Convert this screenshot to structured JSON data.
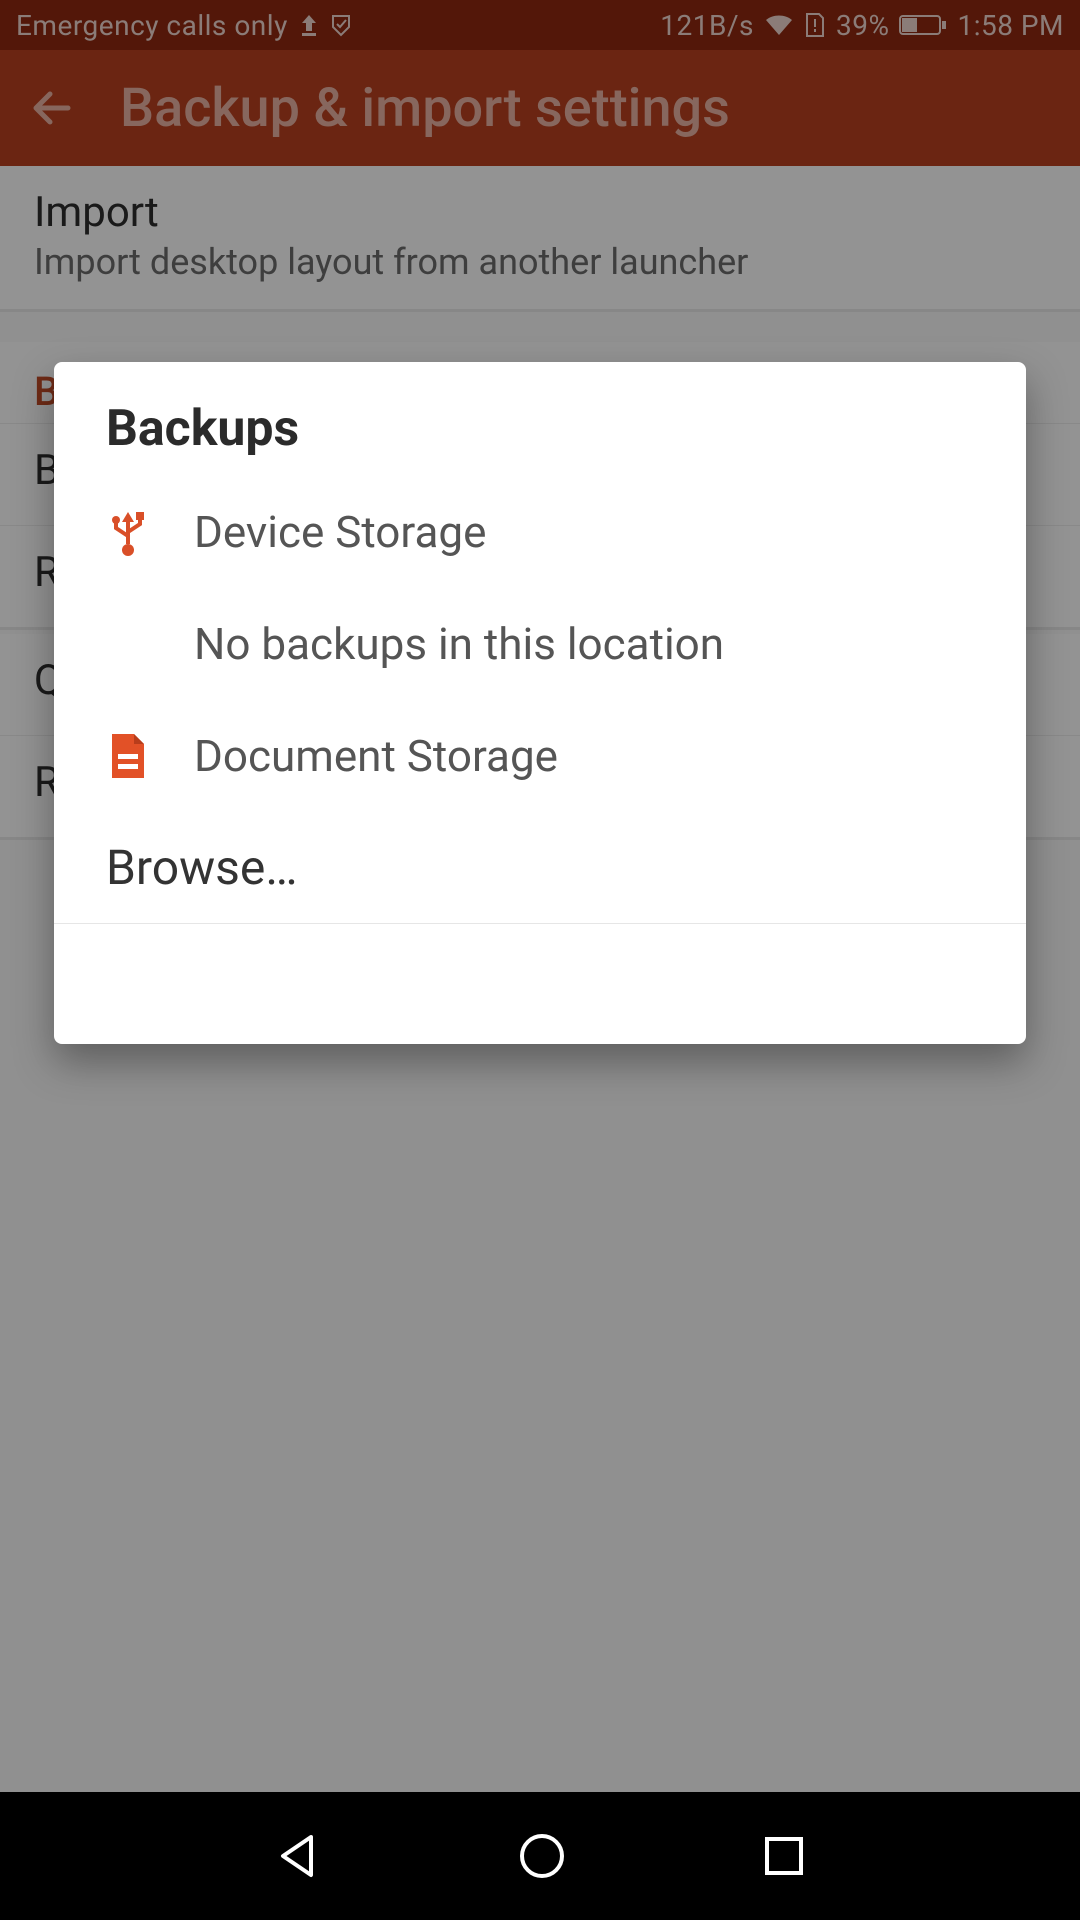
{
  "status": {
    "network_text": "Emergency calls only",
    "data_rate": "121B/s",
    "battery_pct": "39%",
    "clock": "1:58 PM"
  },
  "header": {
    "title": "Backup & import settings"
  },
  "settings": {
    "import": {
      "title": "Import",
      "subtitle": "Import desktop layout from another launcher"
    },
    "section_backup_header": "B",
    "rows": [
      "B",
      "R",
      "Q",
      "R"
    ]
  },
  "dialog": {
    "title": "Backups",
    "device_storage": "Device Storage",
    "no_backups": "No backups in this location",
    "document_storage": "Document Storage",
    "browse": "Browse…"
  }
}
